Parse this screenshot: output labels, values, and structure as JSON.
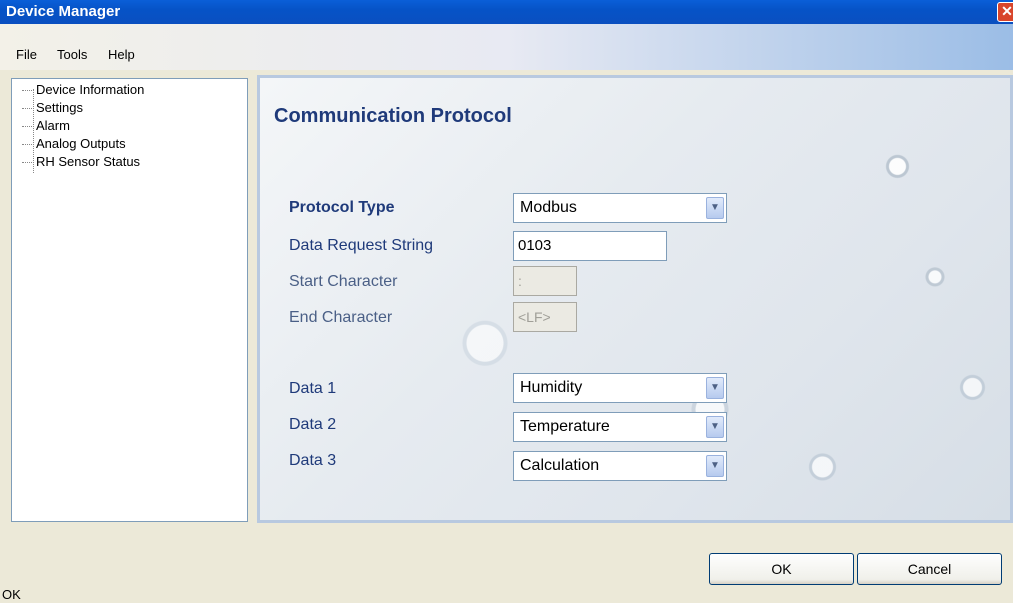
{
  "window": {
    "title": "Device Manager",
    "close_glyph": "✕"
  },
  "menu": [
    {
      "label": "File"
    },
    {
      "label": "Tools"
    },
    {
      "label": "Help"
    }
  ],
  "tree": {
    "items": [
      {
        "label": "Device Information"
      },
      {
        "label": "Settings"
      },
      {
        "label": "Alarm"
      },
      {
        "label": "Analog Outputs"
      },
      {
        "label": "RH Sensor Status"
      }
    ]
  },
  "panel": {
    "title": "Communication Protocol",
    "protocol_type": {
      "label": "Protocol Type",
      "value": "Modbus"
    },
    "data_request_string": {
      "label": "Data Request String",
      "value": "0103"
    },
    "start_character": {
      "label": "Start Character",
      "value": ":"
    },
    "end_character": {
      "label": "End Character",
      "value": "<LF>"
    },
    "data1": {
      "label": "Data 1",
      "value": "Humidity"
    },
    "data2": {
      "label": "Data 2",
      "value": "Temperature"
    },
    "data3": {
      "label": "Data 3",
      "value": "Calculation"
    }
  },
  "buttons": {
    "ok": "OK",
    "cancel": "Cancel"
  },
  "status": {
    "text": "OK"
  },
  "icons": {
    "dropdown_arrow": "chevron-down-icon",
    "close": "close-icon"
  },
  "colors": {
    "label_color": "#1f3a7a",
    "titlebar": "#0653c7"
  }
}
